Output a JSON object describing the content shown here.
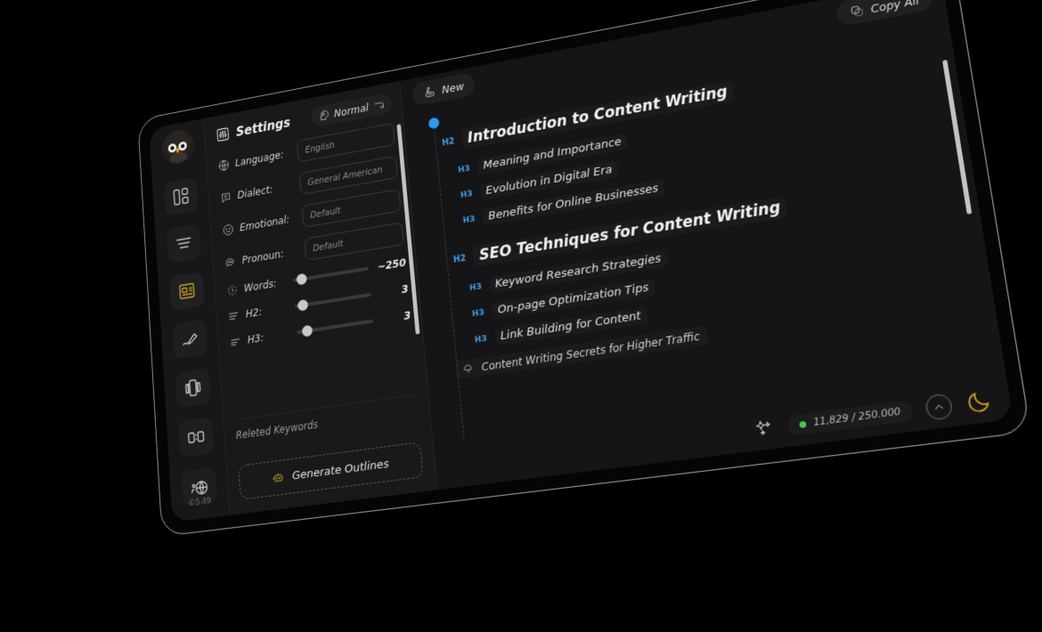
{
  "app": {
    "version_label": "©5.49"
  },
  "sidebar": {
    "avatar_name": "owl-avatar",
    "items": [
      {
        "name": "dashboard",
        "icon": "dashboard-icon",
        "active": false
      },
      {
        "name": "lines",
        "icon": "lines-icon",
        "active": false
      },
      {
        "name": "article",
        "icon": "article-icon",
        "active": true
      },
      {
        "name": "edit",
        "icon": "pen-icon",
        "active": false
      },
      {
        "name": "cards",
        "icon": "cards-icon",
        "active": false
      },
      {
        "name": "timer",
        "icon": "digital-clock-icon",
        "active": false
      },
      {
        "name": "network",
        "icon": "globe-person-icon",
        "active": false
      }
    ]
  },
  "settings": {
    "title": "Settings",
    "title_icon": "sliders-icon",
    "mode": {
      "label": "Normal",
      "icon": "head-brain-icon",
      "swap_icon": "swap-arrow-icon"
    },
    "fields": [
      {
        "label": "Language:",
        "icon": "globe-icon",
        "value": "English"
      },
      {
        "label": "Dialect:",
        "icon": "speech-icon",
        "value": "General American"
      },
      {
        "label": "Emotional:",
        "icon": "smiley-icon",
        "value": "Default"
      },
      {
        "label": "Pronoun:",
        "icon": "bubble-icon",
        "value": "Default"
      }
    ],
    "sliders": [
      {
        "label": "Words:",
        "icon": "clock-icon",
        "value": "~250",
        "pos": 12
      },
      {
        "label": "H2:",
        "icon": "h2-lines-icon",
        "value": "3",
        "pos": 10
      },
      {
        "label": "H3:",
        "icon": "h3-lines-icon",
        "value": "3",
        "pos": 14
      }
    ],
    "keywords_label": "Releted Keywords",
    "generate": {
      "label": "Generate Outlines",
      "icon": "robot-icon"
    }
  },
  "main": {
    "new_button": {
      "label": "New",
      "icon": "write-icon"
    },
    "copy_all_button": {
      "label": "Copy All",
      "icon": "copy-icon"
    },
    "outline": [
      {
        "tag": "H2",
        "text": "Introduction to Content Writing",
        "children": [
          {
            "tag": "H3",
            "text": "Meaning and Importance"
          },
          {
            "tag": "H3",
            "text": "Evolution in Digital Era"
          },
          {
            "tag": "H3",
            "text": "Benefits for Online Businesses"
          }
        ]
      },
      {
        "tag": "H2",
        "text": "SEO Techniques for Content Writing",
        "children": [
          {
            "tag": "H3",
            "text": "Keyword Research Strategies"
          },
          {
            "tag": "H3",
            "text": "On-page Optimization Tips"
          },
          {
            "tag": "H3",
            "text": "Link Building for Content"
          }
        ]
      }
    ],
    "footnote": {
      "text": "Content Writing Secrets for Higher Traffic",
      "icon": "cloud-idea-icon"
    }
  },
  "statusbar": {
    "sparkle_icon": "sparkles-icon",
    "status_dot_color": "#3fd04a",
    "credits": "11,829 / 250.000",
    "collapse_button_icon": "chevron-up-icon",
    "theme_button_icon": "moon-icon"
  },
  "colors": {
    "accent_blue": "#2e9bf0",
    "accent_yellow": "#d9a425",
    "status_green": "#3fd04a"
  }
}
